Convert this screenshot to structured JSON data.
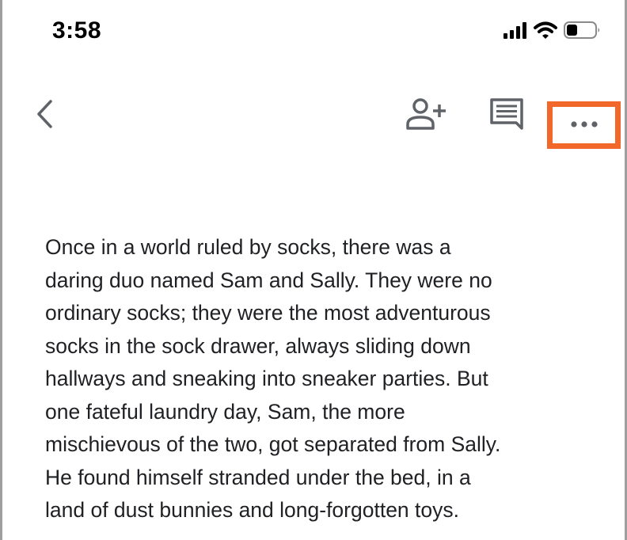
{
  "status_bar": {
    "time": "3:58",
    "icons": [
      "signal-icon",
      "wifi-icon",
      "battery-icon"
    ]
  },
  "toolbar": {
    "back": "back-icon",
    "add_person": "person-add-icon",
    "comments": "comment-icon",
    "more": "more-horizontal-icon",
    "highlight_color": "#f2672a"
  },
  "document": {
    "lines": [
      "Once in a world ruled by socks, there was a",
      "daring duo named Sam and Sally. They were no",
      "ordinary socks; they were the most adventurous",
      "socks in the sock drawer, always sliding down",
      "hallways and sneaking into sneaker parties. But",
      "one fateful laundry day, Sam, the more",
      "mischievous of the two, got separated from Sally.",
      "He found himself stranded under the bed, in a",
      "land of dust bunnies and long-forgotten toys."
    ]
  }
}
